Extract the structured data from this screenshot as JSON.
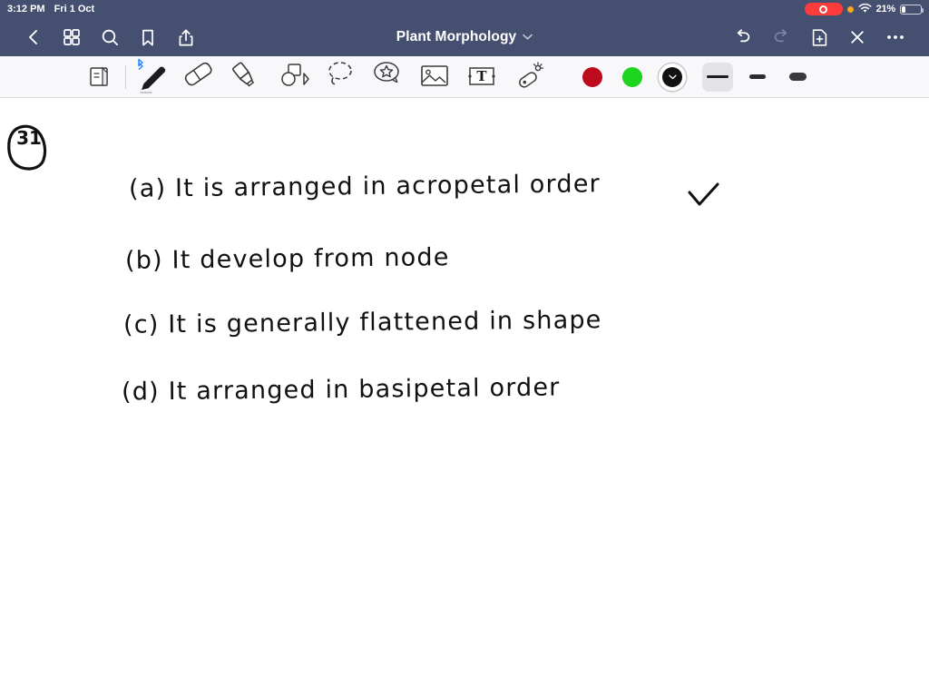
{
  "status_bar": {
    "time": "3:12 PM",
    "date": "Fri 1 Oct",
    "battery_percent": "21%",
    "battery_level": 21,
    "icons": [
      "screen-recording-indicator",
      "orange-privacy-dot",
      "wifi-icon",
      "battery-icon"
    ],
    "background_color": "#454f70"
  },
  "nav_bar": {
    "title": "Plant Morphology",
    "title_chevron": "chevron-down-icon",
    "left_buttons": [
      {
        "name": "back-button",
        "icon": "chevron-left-icon"
      },
      {
        "name": "page-thumbnails-button",
        "icon": "grid-icon"
      },
      {
        "name": "search-button",
        "icon": "search-icon"
      },
      {
        "name": "bookmark-button",
        "icon": "bookmark-icon"
      },
      {
        "name": "share-button",
        "icon": "share-icon"
      }
    ],
    "right_buttons": [
      {
        "name": "undo-button",
        "icon": "undo-icon",
        "enabled": true
      },
      {
        "name": "redo-button",
        "icon": "redo-icon",
        "enabled": false
      },
      {
        "name": "add-page-button",
        "icon": "document-plus-icon"
      },
      {
        "name": "close-button",
        "icon": "close-x-icon"
      },
      {
        "name": "more-options-button",
        "icon": "ellipsis-icon"
      }
    ],
    "background_color": "#454f70"
  },
  "toolbar": {
    "background_color": "#f8f8fa",
    "tools": [
      {
        "name": "page-flip-tool",
        "icon": "page-flip-icon",
        "selected": false
      },
      {
        "name": "pen-tool",
        "icon": "pen-icon",
        "selected": true,
        "badge": "bluetooth-icon"
      },
      {
        "name": "eraser-tool",
        "icon": "eraser-icon",
        "selected": false
      },
      {
        "name": "highlighter-tool",
        "icon": "highlighter-icon",
        "selected": false
      },
      {
        "name": "shapes-tool",
        "icon": "shapes-icon",
        "selected": false
      },
      {
        "name": "lasso-select-tool",
        "icon": "lasso-icon",
        "selected": false
      },
      {
        "name": "sticker-tool",
        "icon": "sticker-star-icon",
        "selected": false
      },
      {
        "name": "image-tool",
        "icon": "image-icon",
        "selected": false
      },
      {
        "name": "text-tool",
        "icon": "text-box-icon",
        "selected": false
      },
      {
        "name": "laser-pointer-tool",
        "icon": "magic-wand-icon",
        "selected": false
      }
    ],
    "colors": [
      {
        "name": "color-swatch-red",
        "hex": "#bd0a1c",
        "selected": false
      },
      {
        "name": "color-swatch-green",
        "hex": "#1ed41e",
        "selected": false
      },
      {
        "name": "color-swatch-black",
        "hex": "#111111",
        "selected": true
      }
    ],
    "stroke_widths": [
      {
        "name": "stroke-width-thin",
        "label": "thin",
        "selected": true
      },
      {
        "name": "stroke-width-medium",
        "label": "medium",
        "selected": false
      },
      {
        "name": "stroke-width-thick",
        "label": "thick",
        "selected": false
      }
    ]
  },
  "canvas": {
    "question_number": "31",
    "handwriting": [
      {
        "id": "option-a",
        "text": "(a) It is arranged in acropetal order",
        "checked": true
      },
      {
        "id": "option-b",
        "text": "(b) It develop from node",
        "checked": false
      },
      {
        "id": "option-c",
        "text": "(c) It is generally flattened in shape",
        "checked": false
      },
      {
        "id": "option-d",
        "text": "(d) It arranged in basipetal order",
        "checked": false
      }
    ],
    "ink_color": "#111111",
    "background_color": "#ffffff"
  }
}
